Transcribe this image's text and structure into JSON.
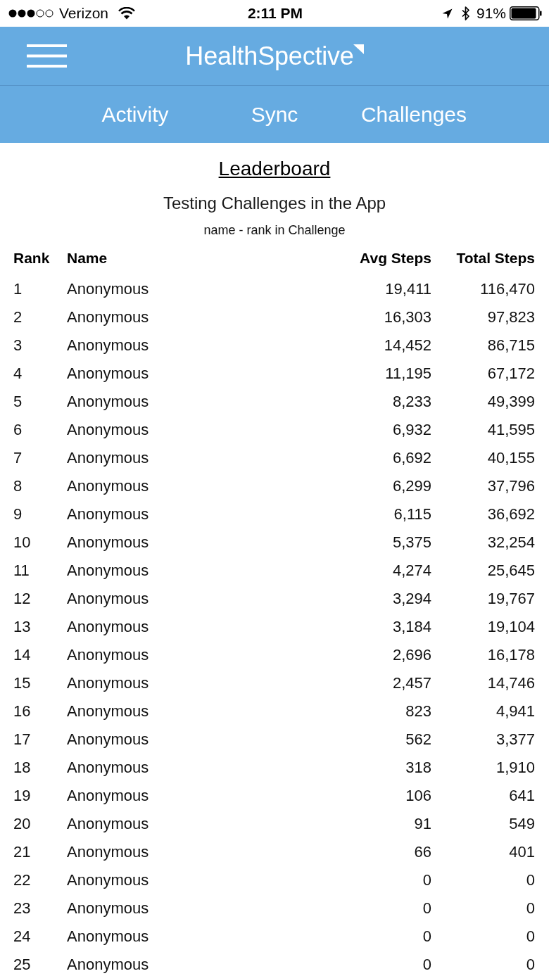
{
  "status_bar": {
    "carrier": "Verizon",
    "time": "2:11 PM",
    "battery": "91%"
  },
  "header": {
    "logo": "HealthSpective"
  },
  "tabs": [
    {
      "label": "Activity"
    },
    {
      "label": "Sync"
    },
    {
      "label": "Challenges"
    }
  ],
  "leaderboard": {
    "title": "Leaderboard",
    "subtitle": "Testing Challenges in the App",
    "caption": "name - rank in Challenge",
    "columns": [
      "Rank",
      "Name",
      "Avg Steps",
      "Total Steps"
    ],
    "rows": [
      [
        "1",
        "Anonymous",
        "19,411",
        "116,470"
      ],
      [
        "2",
        "Anonymous",
        "16,303",
        "97,823"
      ],
      [
        "3",
        "Anonymous",
        "14,452",
        "86,715"
      ],
      [
        "4",
        "Anonymous",
        "11,195",
        "67,172"
      ],
      [
        "5",
        "Anonymous",
        "8,233",
        "49,399"
      ],
      [
        "6",
        "Anonymous",
        "6,932",
        "41,595"
      ],
      [
        "7",
        "Anonymous",
        "6,692",
        "40,155"
      ],
      [
        "8",
        "Anonymous",
        "6,299",
        "37,796"
      ],
      [
        "9",
        "Anonymous",
        "6,115",
        "36,692"
      ],
      [
        "10",
        "Anonymous",
        "5,375",
        "32,254"
      ],
      [
        "11",
        "Anonymous",
        "4,274",
        "25,645"
      ],
      [
        "12",
        "Anonymous",
        "3,294",
        "19,767"
      ],
      [
        "13",
        "Anonymous",
        "3,184",
        "19,104"
      ],
      [
        "14",
        "Anonymous",
        "2,696",
        "16,178"
      ],
      [
        "15",
        "Anonymous",
        "2,457",
        "14,746"
      ],
      [
        "16",
        "Anonymous",
        "823",
        "4,941"
      ],
      [
        "17",
        "Anonymous",
        "562",
        "3,377"
      ],
      [
        "18",
        "Anonymous",
        "318",
        "1,910"
      ],
      [
        "19",
        "Anonymous",
        "106",
        "641"
      ],
      [
        "20",
        "Anonymous",
        "91",
        "549"
      ],
      [
        "21",
        "Anonymous",
        "66",
        "401"
      ],
      [
        "22",
        "Anonymous",
        "0",
        "0"
      ],
      [
        "23",
        "Anonymous",
        "0",
        "0"
      ],
      [
        "24",
        "Anonymous",
        "0",
        "0"
      ],
      [
        "25",
        "Anonymous",
        "0",
        "0"
      ]
    ]
  }
}
